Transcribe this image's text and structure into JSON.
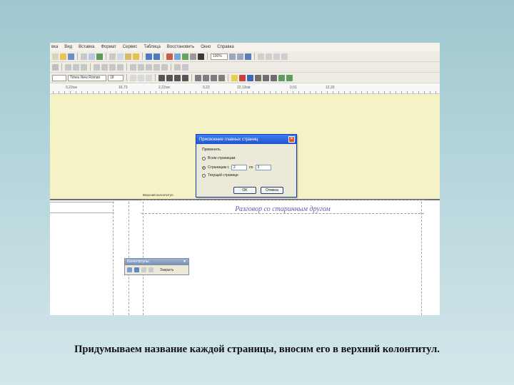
{
  "menu": {
    "items": [
      "вка",
      "Вид",
      "Вставка",
      "Формат",
      "Сервис",
      "Таблица",
      "Восстановить",
      "Окно",
      "Справка"
    ]
  },
  "toolbar": {
    "zoom_value": "100%",
    "style_value": "",
    "font_name": "Times New Roman",
    "font_size": "18"
  },
  "ruler": {
    "fields": [
      "0,22см",
      "16,73",
      "2,22см",
      "0,22",
      "22,13см",
      "0,01",
      "12,33"
    ]
  },
  "dialog": {
    "title": "Присвоение главных страниц",
    "section_label": "Применить",
    "options": [
      "Всем страницам",
      "Страницам с",
      "Текущей странице"
    ],
    "from_label": "по",
    "from_value": "2",
    "to_value": "3",
    "ok_label": "OK",
    "cancel_label": "Отмена"
  },
  "page": {
    "header_tag": "Верхний колонтитул",
    "header_text": "Разговор со старинным другом"
  },
  "floating_toolbar": {
    "title": "Колонтитулы",
    "close_label": "Закрыть"
  },
  "caption": "Придумываем название каждой страницы, вносим его в верхний колонтитул.",
  "colors": {
    "background": "#b6d6dc",
    "band": "#f5f3c6",
    "header_text": "#6d56a6",
    "dialog_title": "#1f55cf"
  }
}
